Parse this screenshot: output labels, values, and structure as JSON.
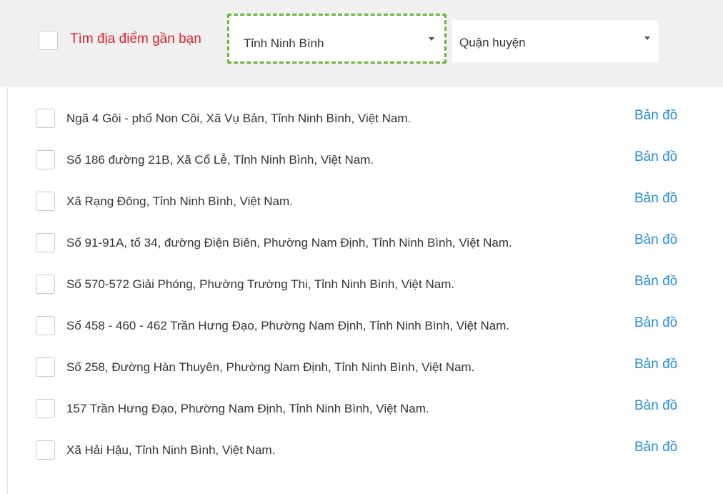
{
  "filter": {
    "nearby_label": "Tìm địa điểm gần bạn",
    "province_value": "Tỉnh Ninh Bình",
    "district_value": "Quận huyện"
  },
  "locations": [
    {
      "address": "Ngã 4 Gôi - phố Non Côi, Xã Vụ Bản, Tỉnh Ninh Bình, Việt Nam.",
      "map_label": "Bản đồ"
    },
    {
      "address": "Số 186 đường 21B, Xã Cổ Lễ, Tỉnh Ninh Bình, Việt Nam.",
      "map_label": "Bản đồ"
    },
    {
      "address": "Xã Rạng Đông, Tỉnh Ninh Bình, Việt Nam.",
      "map_label": "Bản đồ"
    },
    {
      "address": "Số 91-91A, tổ 34, đường Điện Biên, Phường Nam Định, Tỉnh Ninh Bình, Việt Nam.",
      "map_label": "Bản đồ"
    },
    {
      "address": "Số 570-572 Giải Phóng, Phường Trường Thi, Tỉnh Ninh Bình, Việt Nam.",
      "map_label": "Bản đồ"
    },
    {
      "address": "Số 458 - 460 - 462 Trần Hưng Đạo, Phường Nam Định, Tỉnh Ninh Bình, Việt Nam.",
      "map_label": "Bản đồ"
    },
    {
      "address": "Số 258, Đường Hàn Thuyên, Phường Nam Định, Tỉnh Ninh Bình, Việt Nam.",
      "map_label": "Bản đồ"
    },
    {
      "address": "157 Trần Hưng Đạo, Phường Nam Định, Tỉnh Ninh Bình, Việt Nam.",
      "map_label": "Bản đồ"
    },
    {
      "address": "Xã Hải Hậu, Tỉnh Ninh Bình, Việt Nam.",
      "map_label": "Bản đồ"
    }
  ]
}
